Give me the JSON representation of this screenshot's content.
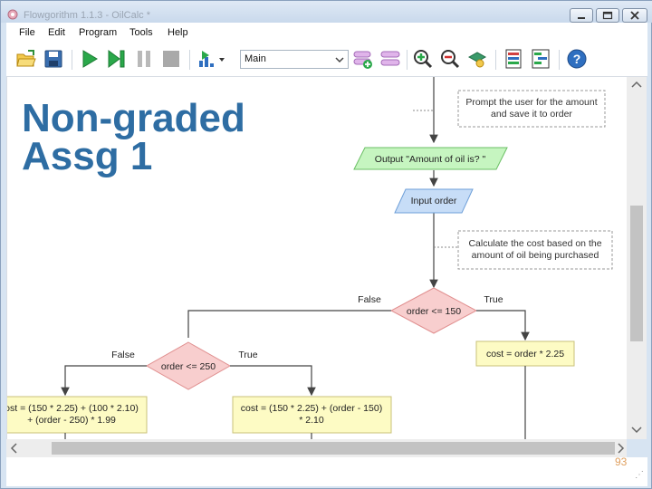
{
  "window": {
    "title": "Flowgorithm 1.1.3 - OilCalc *"
  },
  "menu": [
    {
      "label": "File"
    },
    {
      "label": "Edit"
    },
    {
      "label": "Program"
    },
    {
      "label": "Tools"
    },
    {
      "label": "Help"
    }
  ],
  "toolbar": {
    "function_select": {
      "value": "Main"
    }
  },
  "overlay": {
    "line1": "Non-graded",
    "line2": "Assg 1"
  },
  "flowchart": {
    "comment1": {
      "line1": "Prompt the user for the amount",
      "line2": "and save it to order"
    },
    "output1": "Output \"Amount of oil is? \"",
    "input1": "Input order",
    "comment2": {
      "line1": "Calculate the cost based on the",
      "line2": "amount of oil being purchased"
    },
    "decision1": {
      "condition": "order <= 150",
      "false_label": "False",
      "true_label": "True"
    },
    "assign_true1": "cost = order * 2.25",
    "decision2": {
      "condition": "order <= 250",
      "false_label": "False",
      "true_label": "True"
    },
    "assign_false2": {
      "line1": "ost = (150 * 2.25) + (100 * 2.10)",
      "line2": "+ (order - 250) * 1.99"
    },
    "assign_true2": {
      "line1": "cost = (150 * 2.25) + (order - 150)",
      "line2": "* 2.10"
    }
  },
  "slide_number": "93",
  "colors": {
    "overlay_text": "#2e6da3",
    "output_fill": "#c6f5c0",
    "input_fill": "#c7ddf7",
    "decision_fill": "#f8cece",
    "assign_fill": "#fdfbc4"
  }
}
